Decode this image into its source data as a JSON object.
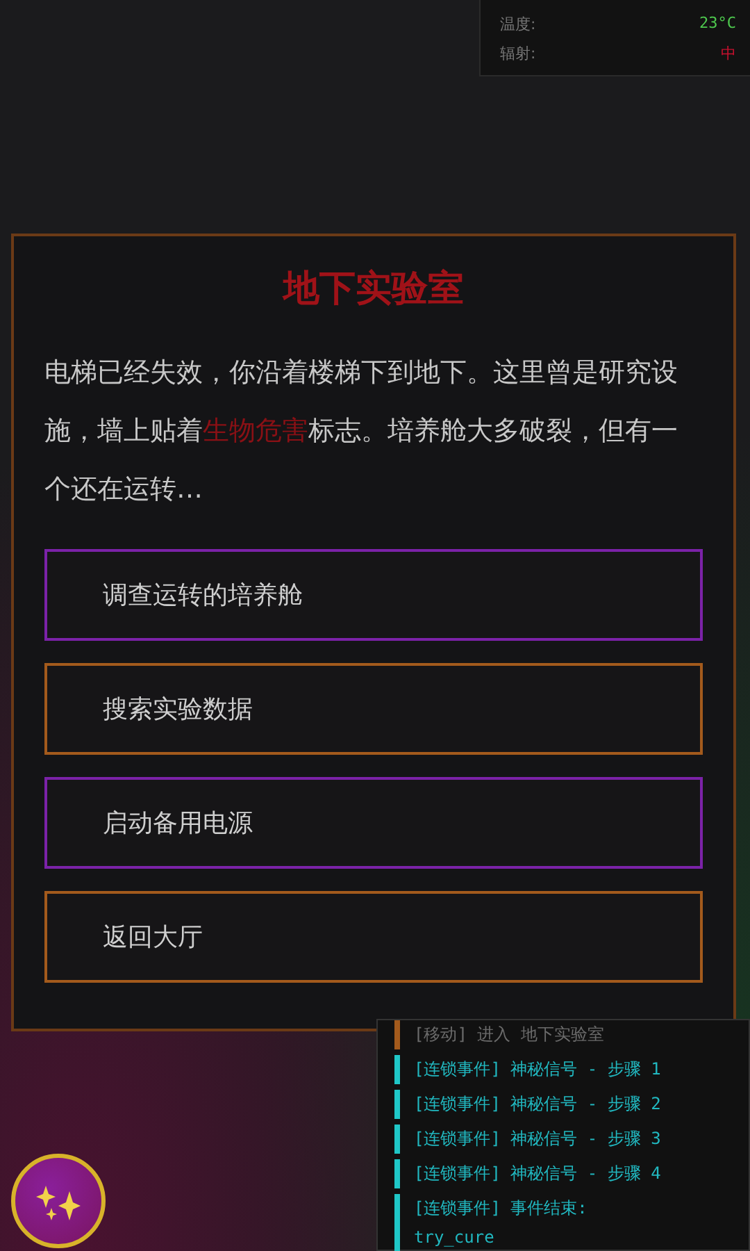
{
  "status_panel": {
    "rows": [
      {
        "label": "温度:",
        "value": "23°C",
        "color": "#4ec94e"
      },
      {
        "label": "辐射:",
        "value": "中",
        "color": "#c8102e"
      }
    ]
  },
  "scene": {
    "title": "地下实验室",
    "description": [
      {
        "text": "电梯已经失效，你沿着楼梯下到地下。这里曾是研究设施，墙上贴着",
        "highlight": false
      },
      {
        "text": "生物危害",
        "highlight": true
      },
      {
        "text": "标志。培养舱大多破裂，但有一个还在运转…",
        "highlight": false
      }
    ],
    "choices": [
      {
        "label": "调查运转的培养舱",
        "color": "#7b22a8"
      },
      {
        "label": "搜索实验数据",
        "color": "#a35a1c"
      },
      {
        "label": "启动备用电源",
        "color": "#7b22a8"
      },
      {
        "label": "返回大厅",
        "color": "#a35a1c"
      }
    ]
  },
  "log": [
    {
      "text": "[移动] 进入 地下实验室",
      "kind": "move"
    },
    {
      "text": "[连锁事件] 神秘信号 - 步骤 1",
      "kind": "chain"
    },
    {
      "text": "[连锁事件] 神秘信号 - 步骤 2",
      "kind": "chain"
    },
    {
      "text": "[连锁事件] 神秘信号 - 步骤 3",
      "kind": "chain"
    },
    {
      "text": "[连锁事件] 神秘信号 - 步骤 4",
      "kind": "chain"
    },
    {
      "text": "[连锁事件] 事件结束:\ntry_cure",
      "kind": "chain"
    }
  ]
}
